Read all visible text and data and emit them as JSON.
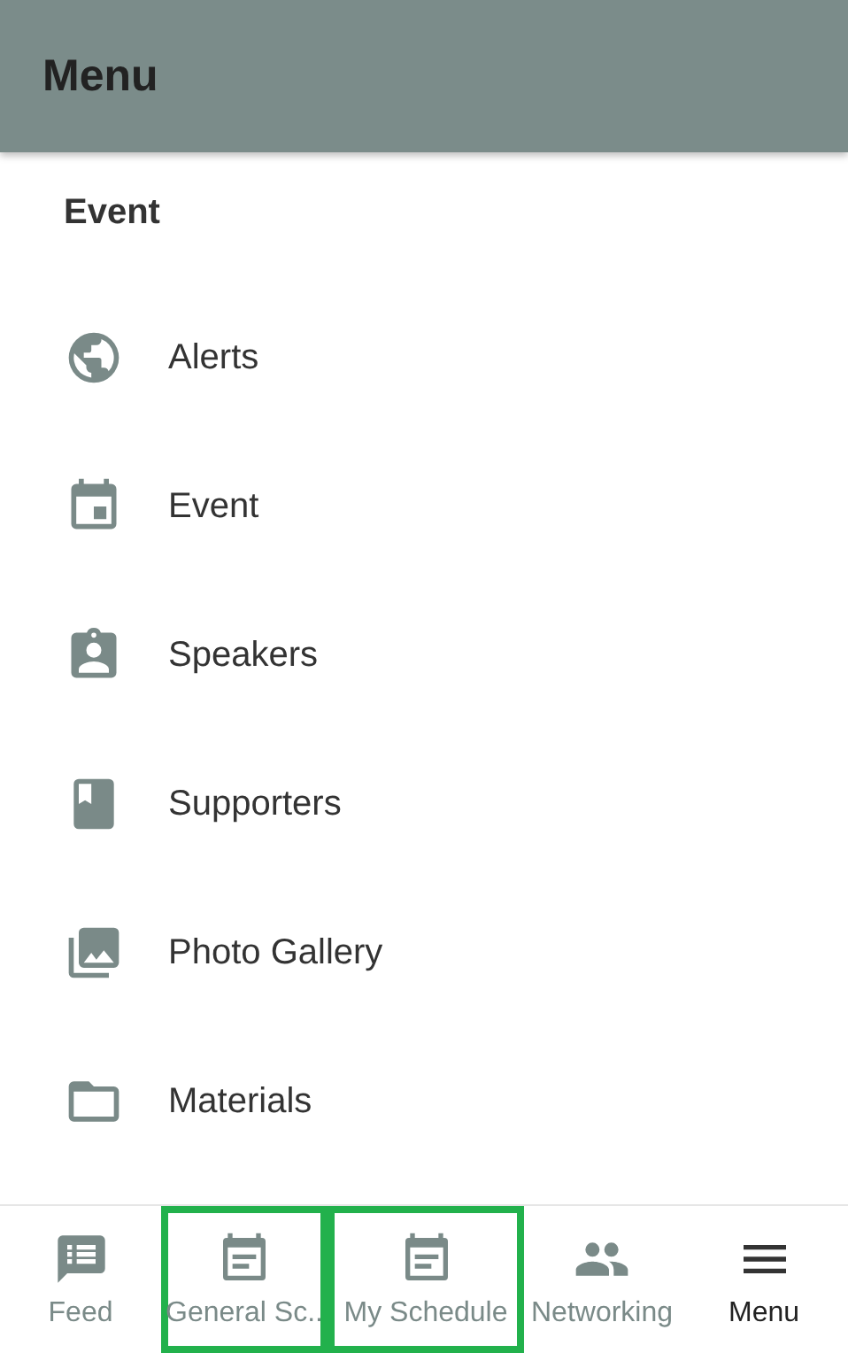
{
  "header": {
    "title": "Menu"
  },
  "section": {
    "title": "Event"
  },
  "items": [
    {
      "kind": "globe",
      "label": "Alerts"
    },
    {
      "kind": "calendar",
      "label": "Event"
    },
    {
      "kind": "badge",
      "label": "Speakers"
    },
    {
      "kind": "book",
      "label": "Supporters"
    },
    {
      "kind": "photos",
      "label": "Photo Gallery"
    },
    {
      "kind": "folder",
      "label": "Materials"
    }
  ],
  "nav": [
    {
      "kind": "feed",
      "label": "Feed",
      "selected": false,
      "highlighted": false
    },
    {
      "kind": "schedule",
      "label": "General Sc..",
      "selected": false,
      "highlighted": true
    },
    {
      "kind": "schedule",
      "label": "My Schedule",
      "selected": false,
      "highlighted": true
    },
    {
      "kind": "people",
      "label": "Networking",
      "selected": false,
      "highlighted": false
    },
    {
      "kind": "menu",
      "label": "Menu",
      "selected": true,
      "highlighted": false
    }
  ]
}
